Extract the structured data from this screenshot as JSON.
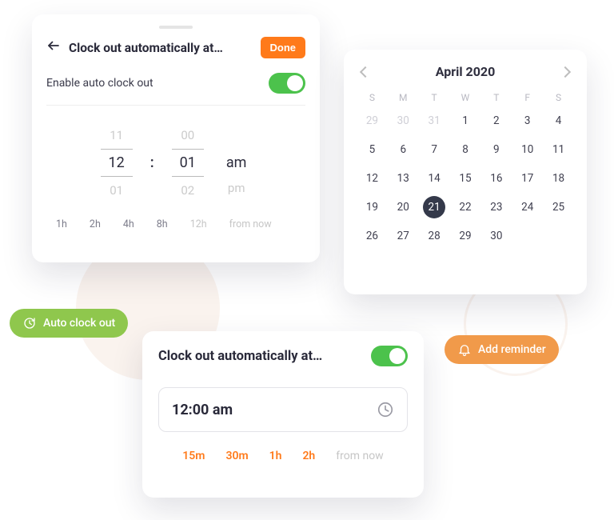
{
  "panelA": {
    "title": "Clock out automatically at…",
    "done": "Done",
    "enable_label": "Enable auto clock out",
    "toggle_on": true,
    "wheel_hour": {
      "prev": "11",
      "sel": "12",
      "next": "01"
    },
    "wheel_min": {
      "prev": "00",
      "sel": "01",
      "next": "02"
    },
    "wheel_ampm": {
      "sel": "am",
      "next": "pm"
    },
    "quick": [
      "1h",
      "2h",
      "4h",
      "8h"
    ],
    "quick_muted": "12h",
    "quick_label": "from now"
  },
  "calendar": {
    "title": "April 2020",
    "dow": [
      "S",
      "M",
      "T",
      "W",
      "T",
      "F",
      "S"
    ],
    "cells": [
      {
        "d": "29",
        "other": true
      },
      {
        "d": "30",
        "other": true
      },
      {
        "d": "31",
        "other": true
      },
      {
        "d": "1"
      },
      {
        "d": "2"
      },
      {
        "d": "3"
      },
      {
        "d": "4"
      },
      {
        "d": "5"
      },
      {
        "d": "6"
      },
      {
        "d": "7"
      },
      {
        "d": "8"
      },
      {
        "d": "9"
      },
      {
        "d": "10"
      },
      {
        "d": "11"
      },
      {
        "d": "12"
      },
      {
        "d": "13"
      },
      {
        "d": "14"
      },
      {
        "d": "15"
      },
      {
        "d": "16"
      },
      {
        "d": "17"
      },
      {
        "d": "18"
      },
      {
        "d": "19"
      },
      {
        "d": "20"
      },
      {
        "d": "21",
        "sel": true
      },
      {
        "d": "22"
      },
      {
        "d": "23"
      },
      {
        "d": "24"
      },
      {
        "d": "25"
      },
      {
        "d": "26"
      },
      {
        "d": "27"
      },
      {
        "d": "28"
      },
      {
        "d": "29"
      },
      {
        "d": "30"
      }
    ]
  },
  "pillAuto": {
    "label": "Auto clock out"
  },
  "pillReminder": {
    "label": "Add reminder"
  },
  "panelC": {
    "title": "Clock out automatically at…",
    "toggle_on": true,
    "time_value": "12:00 am",
    "quick": [
      "15m",
      "30m",
      "1h",
      "2h"
    ],
    "quick_label": "from now"
  },
  "colors": {
    "accent_orange": "#ff7a1a",
    "accent_green": "#4cc24c"
  }
}
